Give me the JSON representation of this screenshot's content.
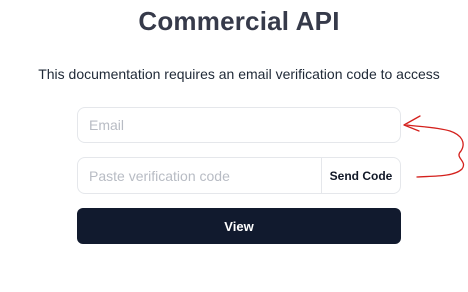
{
  "page": {
    "title": "Commercial API",
    "subtitle": "This documentation requires an email verification code to access"
  },
  "form": {
    "email_placeholder": "Email",
    "code_placeholder": "Paste verification code",
    "send_code_label": "Send Code",
    "view_label": "View"
  },
  "colors": {
    "title_text": "#363a4a",
    "primary_button": "#111a2e",
    "annotation_stroke": "#d4201c",
    "field_border": "#e5e7eb"
  }
}
